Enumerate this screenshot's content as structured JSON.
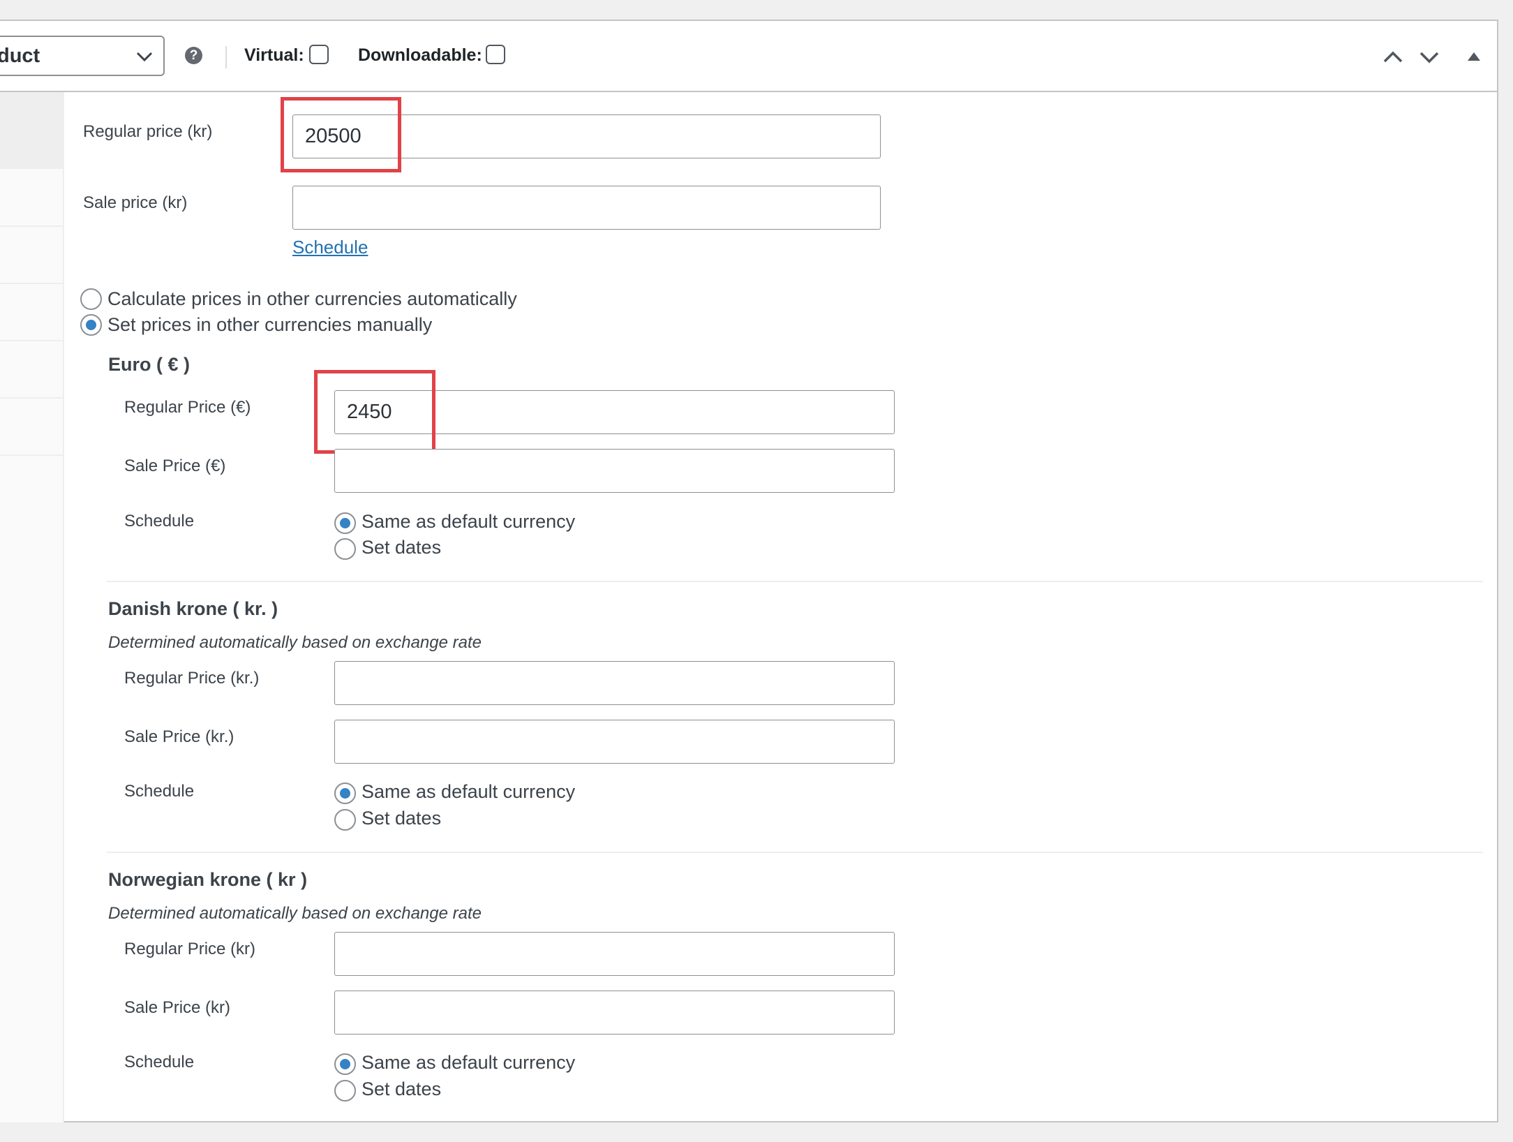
{
  "header": {
    "product_type_value": "duct",
    "help_glyph": "?",
    "virtual_label": "Virtual:",
    "downloadable_label": "Downloadable:",
    "icons": [
      "chevron-down-icon",
      "help-icon",
      "arrow-up-icon",
      "arrow-down-icon",
      "toggle-triangle-icon"
    ]
  },
  "general": {
    "regular_price_label": "Regular price (kr)",
    "regular_price_value": "20500",
    "sale_price_label": "Sale price (kr)",
    "sale_price_value": "",
    "schedule_link": "Schedule"
  },
  "currency_mode": {
    "auto_label": "Calculate prices in other currencies automatically",
    "manual_label": "Set prices in other currencies manually",
    "selected": "manual"
  },
  "currencies": [
    {
      "title": "Euro ( € )",
      "note": "",
      "regular_label": "Regular Price (€)",
      "regular_value": "2450",
      "sale_label": "Sale Price (€)",
      "sale_value": "",
      "schedule_label": "Schedule",
      "schedule_same": "Same as default currency",
      "schedule_dates": "Set dates",
      "schedule_selected": "same"
    },
    {
      "title": "Danish krone ( kr. )",
      "note": "Determined automatically based on exchange rate",
      "regular_label": "Regular Price (kr.)",
      "regular_value": "",
      "sale_label": "Sale Price (kr.)",
      "sale_value": "",
      "schedule_label": "Schedule",
      "schedule_same": "Same as default currency",
      "schedule_dates": "Set dates",
      "schedule_selected": "same"
    },
    {
      "title": "Norwegian krone ( kr )",
      "note": "Determined automatically based on exchange rate",
      "regular_label": "Regular Price (kr)",
      "regular_value": "",
      "sale_label": "Sale Price (kr)",
      "sale_value": "",
      "schedule_label": "Schedule",
      "schedule_same": "Same as default currency",
      "schedule_dates": "Set dates",
      "schedule_selected": "same"
    }
  ],
  "colors": {
    "highlight": "#e04347",
    "radio_selected": "#3582c4",
    "link": "#2271b1"
  }
}
